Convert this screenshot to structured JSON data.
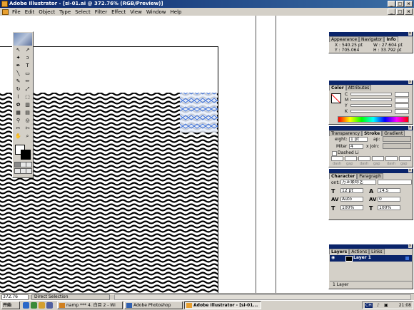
{
  "window": {
    "title": "Adobe Illustrator - [si-01.ai @ 372.76% (RGB/Preview)]",
    "controls": [
      "_",
      "□",
      "×"
    ]
  },
  "menu": [
    "File",
    "Edit",
    "Object",
    "Type",
    "Select",
    "Filter",
    "Effect",
    "View",
    "Window",
    "Help"
  ],
  "info_panel": {
    "tabs": [
      "Appearance",
      "Navigator",
      "Info"
    ],
    "x": "X : 540.25 pt",
    "y": "Y : 705.064",
    "w": "W : 27.604 pt",
    "h": "H : 33.792 pt"
  },
  "color_panel": {
    "tabs": [
      "Color",
      "Attributes"
    ],
    "channels": [
      "C",
      "M",
      "Y",
      "K"
    ]
  },
  "stroke_panel": {
    "tabs": [
      "Transparency",
      "Stroke",
      "Gradient"
    ],
    "weight_label": "eight:",
    "weight_value": "1 pt",
    "cap_label": "ap:",
    "miter_label": "Miter",
    "miter_value": "4",
    "join_label": "x Join:",
    "dashed_label": "Dashed Li",
    "dash_fields": [
      "dash",
      "gap",
      "dash",
      "gap",
      "dash",
      "gap"
    ]
  },
  "character_panel": {
    "tabs": [
      "Character",
      "Paragraph"
    ],
    "font_label": "ont:",
    "font_value": "方正繁综艺",
    "size_value": "12 pt",
    "leading_value": "14.5",
    "kerning_value": "Auto",
    "tracking_value": "0",
    "hscale_value": "100%",
    "vscale_value": "100%"
  },
  "layers_panel": {
    "tabs": [
      "Layers",
      "Actions",
      "Links"
    ],
    "layer_name": "Layer 1",
    "footer": "1 Layer"
  },
  "status": {
    "zoom": "372.76",
    "tool": "Direct Selection"
  },
  "taskbar": {
    "start": "开始",
    "tasks": [
      "namp *** 4. 白目 2 - Wi",
      "Adobe Photoshop",
      "Adobe Illustrator - [si-01..."
    ],
    "clock": "21:08",
    "tray_text": "CH"
  },
  "colors": {
    "title_blue": "#0a246a",
    "face": "#d4d0c8",
    "selection_blue": "#3a6fd8"
  }
}
